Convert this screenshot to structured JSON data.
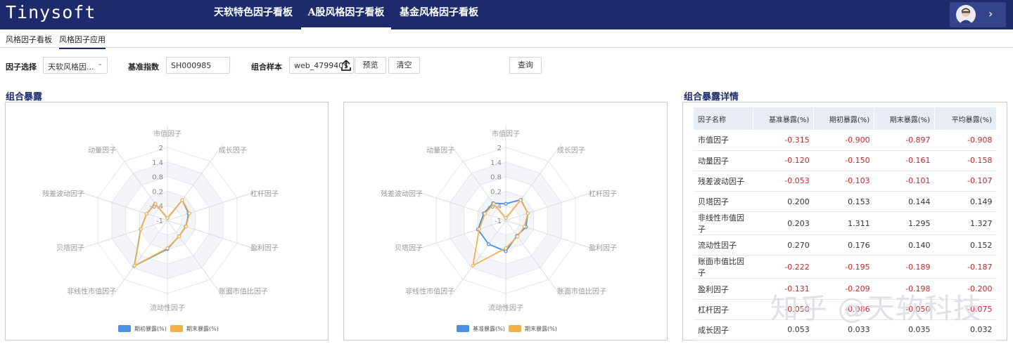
{
  "app": {
    "logo": "Tinysoft",
    "nav_tabs": [
      {
        "label": "天软特色因子看板",
        "active": false
      },
      {
        "label": "A股风格因子看板",
        "active": true
      },
      {
        "label": "基金风格因子看板",
        "active": false
      }
    ],
    "user_chevron": "›"
  },
  "subtabs": [
    {
      "label": "风格因子看板",
      "active": false
    },
    {
      "label": "风格因子应用",
      "active": true
    }
  ],
  "filters": {
    "factor_label": "因子选择",
    "factor_value": "天软风格因...",
    "benchmark_label": "基准指数",
    "benchmark_value": "SH000985",
    "sample_label": "组合样本",
    "sample_value": "web_479940$",
    "preview_label": "预览",
    "clear_label": "清空",
    "query_label": "查询"
  },
  "sections": {
    "exposure_title": "组合暴露",
    "detail_title": "组合暴露详情"
  },
  "colors": {
    "nav": "#1d2b6d",
    "series_blue": "#4a8fe0",
    "series_orange": "#f2b24a",
    "negative": "#c6282e"
  },
  "chart_data": [
    {
      "type": "radar",
      "axes": [
        "市值因子",
        "成长因子",
        "杠杆因子",
        "盈利因子",
        "账面市值比因子",
        "流动性因子",
        "非线性市值因子",
        "贝塔因子",
        "残差波动因子",
        "动量因子"
      ],
      "ticks": [
        "2",
        "1.4",
        "0.8",
        "0.2",
        "-0.4",
        "-1"
      ],
      "range": [
        -1,
        2
      ],
      "series": [
        {
          "name": "期初暴露(%)",
          "color": "#4a8fe0",
          "values": [
            -0.9,
            0.033,
            -0.086,
            -0.209,
            -0.195,
            0.176,
            1.311,
            0.153,
            -0.103,
            -0.15
          ]
        },
        {
          "name": "期末暴露(%)",
          "color": "#f2b24a",
          "values": [
            -0.897,
            0.035,
            -0.05,
            -0.198,
            -0.189,
            0.14,
            1.295,
            0.144,
            -0.101,
            -0.161
          ]
        }
      ],
      "legend_position": "bottom"
    },
    {
      "type": "radar",
      "axes": [
        "市值因子",
        "成长因子",
        "杠杆因子",
        "盈利因子",
        "账面市值比因子",
        "流动性因子",
        "非线性市值因子",
        "贝塔因子",
        "残差波动因子",
        "动量因子"
      ],
      "ticks": [
        "2",
        "1.4",
        "0.8",
        "0.2",
        "-0.4",
        "-1"
      ],
      "range": [
        -1,
        2
      ],
      "series": [
        {
          "name": "基准暴露(%)",
          "color": "#4a8fe0",
          "values": [
            -0.315,
            0.053,
            -0.05,
            -0.131,
            -0.222,
            0.27,
            0.203,
            0.2,
            -0.053,
            -0.12
          ]
        },
        {
          "name": "期末暴露(%)",
          "color": "#f2b24a",
          "values": [
            -0.897,
            0.035,
            -0.05,
            -0.198,
            -0.189,
            0.14,
            1.295,
            0.144,
            -0.101,
            -0.161
          ]
        }
      ],
      "legend_position": "bottom"
    }
  ],
  "table": {
    "headers": [
      "因子名称",
      "基准暴露(%)",
      "期初暴露(%)",
      "期末暴露(%)",
      "平均暴露(%)"
    ],
    "rows": [
      {
        "name": "市值因子",
        "values": [
          "-0.315",
          "-0.900",
          "-0.897",
          "-0.908"
        ]
      },
      {
        "name": "动量因子",
        "values": [
          "-0.120",
          "-0.150",
          "-0.161",
          "-0.158"
        ]
      },
      {
        "name": "残差波动因子",
        "values": [
          "-0.053",
          "-0.103",
          "-0.101",
          "-0.107"
        ]
      },
      {
        "name": "贝塔因子",
        "values": [
          "0.200",
          "0.153",
          "0.144",
          "0.149"
        ]
      },
      {
        "name": "非线性市值因子",
        "values": [
          "0.203",
          "1.311",
          "1.295",
          "1.327"
        ]
      },
      {
        "name": "流动性因子",
        "values": [
          "0.270",
          "0.176",
          "0.140",
          "0.152"
        ]
      },
      {
        "name": "账面市值比因子",
        "values": [
          "-0.222",
          "-0.195",
          "-0.189",
          "-0.187"
        ]
      },
      {
        "name": "盈利因子",
        "values": [
          "-0.131",
          "-0.209",
          "-0.198",
          "-0.200"
        ]
      },
      {
        "name": "杠杆因子",
        "values": [
          "-0.050",
          "-0.086",
          "-0.050",
          "-0.075"
        ]
      },
      {
        "name": "成长因子",
        "values": [
          "0.053",
          "0.033",
          "0.035",
          "0.032"
        ]
      }
    ]
  },
  "watermark": "知乎 @天软科技"
}
